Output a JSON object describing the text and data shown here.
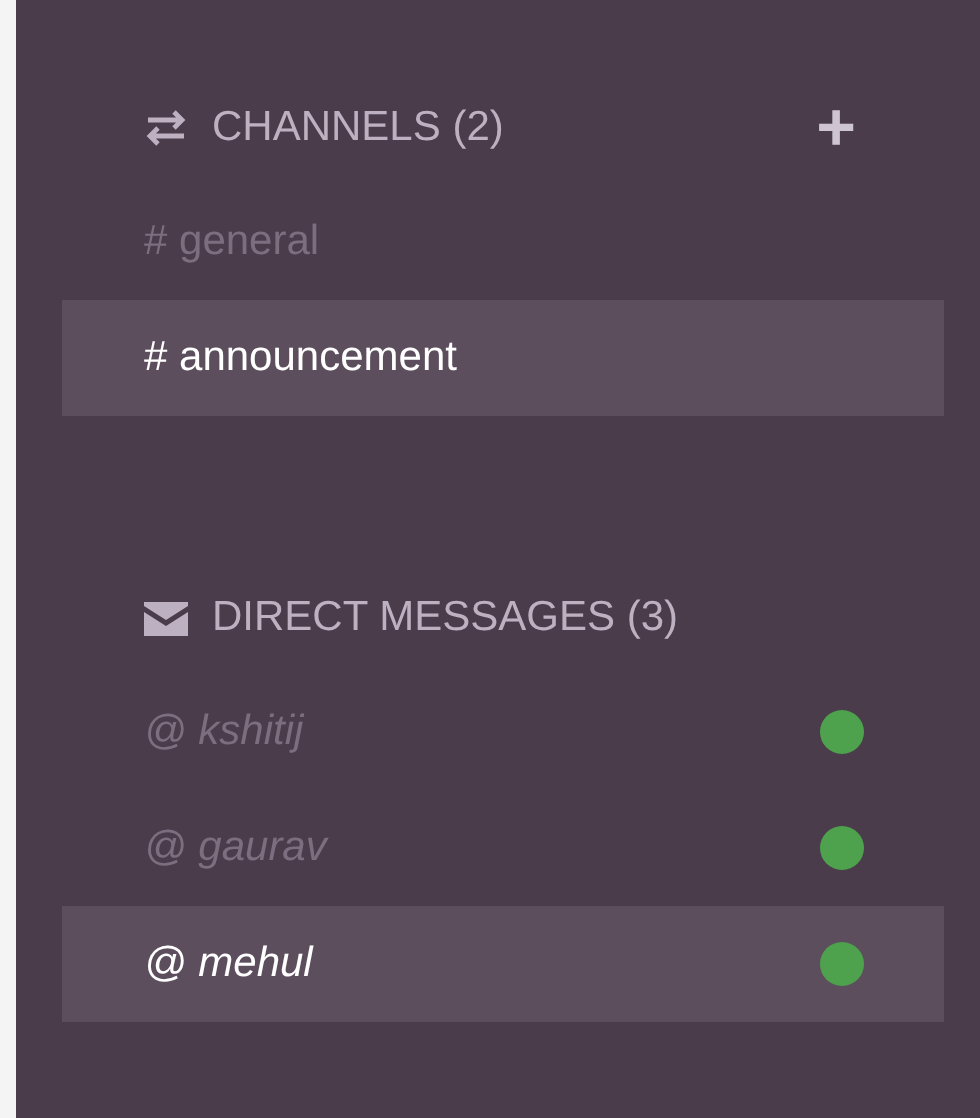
{
  "sections": [
    {
      "kind": "channels",
      "title": "CHANNELS (2)",
      "add": "+",
      "items": [
        {
          "label": "# general",
          "selected": false
        },
        {
          "label": "# announcement",
          "selected": true
        }
      ]
    },
    {
      "kind": "direct",
      "title": "DIRECT MESSAGES (3)",
      "items": [
        {
          "label": "@ kshitij",
          "selected": false,
          "online": true
        },
        {
          "label": "@ gaurav",
          "selected": false,
          "online": true
        },
        {
          "label": "@ mehul",
          "selected": true,
          "online": true
        }
      ]
    }
  ]
}
